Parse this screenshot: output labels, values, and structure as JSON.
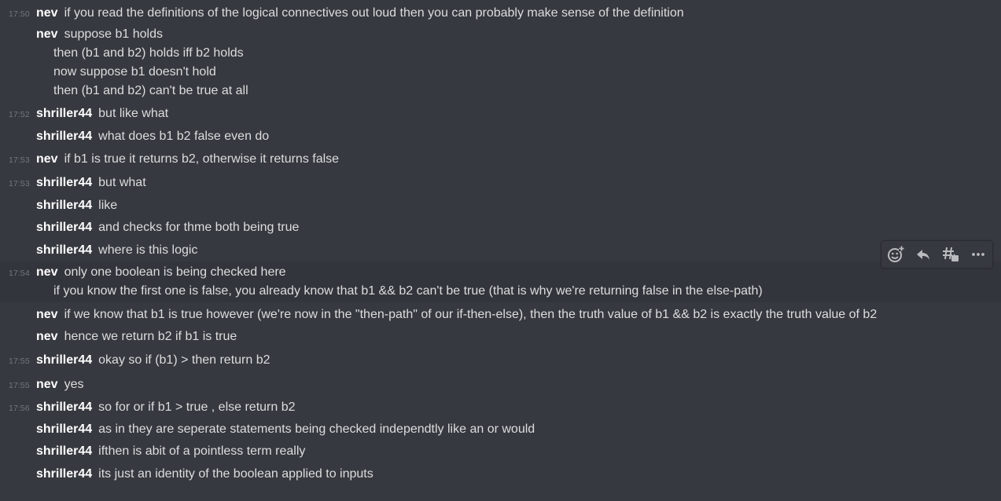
{
  "messages": [
    {
      "time": "17:50",
      "author": "nev",
      "lines": [
        "if you read the definitions of the logical connectives out loud then you can probably make sense of the definition"
      ]
    },
    {
      "time": "",
      "author": "nev",
      "lines": [
        "suppose b1 holds",
        "then (b1 and b2) holds iff b2 holds",
        "now suppose b1 doesn't hold",
        "then (b1 and b2) can't be true at all"
      ]
    },
    {
      "time": "17:52",
      "author": "shriller44",
      "lines": [
        "but like what"
      ]
    },
    {
      "time": "",
      "author": "shriller44",
      "lines": [
        "what does b1 b2 false even do"
      ]
    },
    {
      "time": "17:53",
      "author": "nev",
      "lines": [
        "if b1 is true it returns b2, otherwise it returns false"
      ]
    },
    {
      "time": "17:53",
      "author": "shriller44",
      "lines": [
        "but what"
      ]
    },
    {
      "time": "",
      "author": "shriller44",
      "lines": [
        "like"
      ]
    },
    {
      "time": "",
      "author": "shriller44",
      "lines": [
        "and checks for thme both being true"
      ]
    },
    {
      "time": "",
      "author": "shriller44",
      "lines": [
        "where is this logic"
      ]
    },
    {
      "time": "17:54",
      "author": "nev",
      "lines": [
        "only one boolean is being checked here",
        "if you know the first one is false, you already know that b1 && b2 can't be true (that is why we're returning false in the else-path)"
      ]
    },
    {
      "time": "",
      "author": "nev",
      "lines": [
        "if we know that b1 is true however (we're now in the \"then-path\" of our if-then-else), then the truth value of b1 && b2 is exactly the truth value of b2"
      ]
    },
    {
      "time": "",
      "author": "nev",
      "lines": [
        "hence we return b2 if b1 is true"
      ]
    },
    {
      "time": "17:55",
      "author": "shriller44",
      "lines": [
        "okay so if (b1) > then return b2"
      ]
    },
    {
      "time": "17:55",
      "author": "nev",
      "lines": [
        "yes"
      ]
    },
    {
      "time": "17:56",
      "author": "shriller44",
      "lines": [
        "so for or if b1 > true , else return b2"
      ]
    },
    {
      "time": "",
      "author": "shriller44",
      "lines": [
        "as in they are seperate statements being checked independtly like an or would"
      ]
    },
    {
      "time": "",
      "author": "shriller44",
      "lines": [
        "ifthen is  abit of a pointless term really"
      ]
    },
    {
      "time": "",
      "author": "shriller44",
      "lines": [
        "its just an identity of the boolean applied to inputs"
      ]
    }
  ],
  "toolbar": {
    "icons": [
      "add-reaction-icon",
      "reply-icon",
      "create-thread-icon",
      "more-icon"
    ]
  },
  "colors": {
    "background": "#36393f",
    "hover_background": "#32353b",
    "author": "#ffffff",
    "text": "#dcddde",
    "timestamp": "#72767d"
  }
}
